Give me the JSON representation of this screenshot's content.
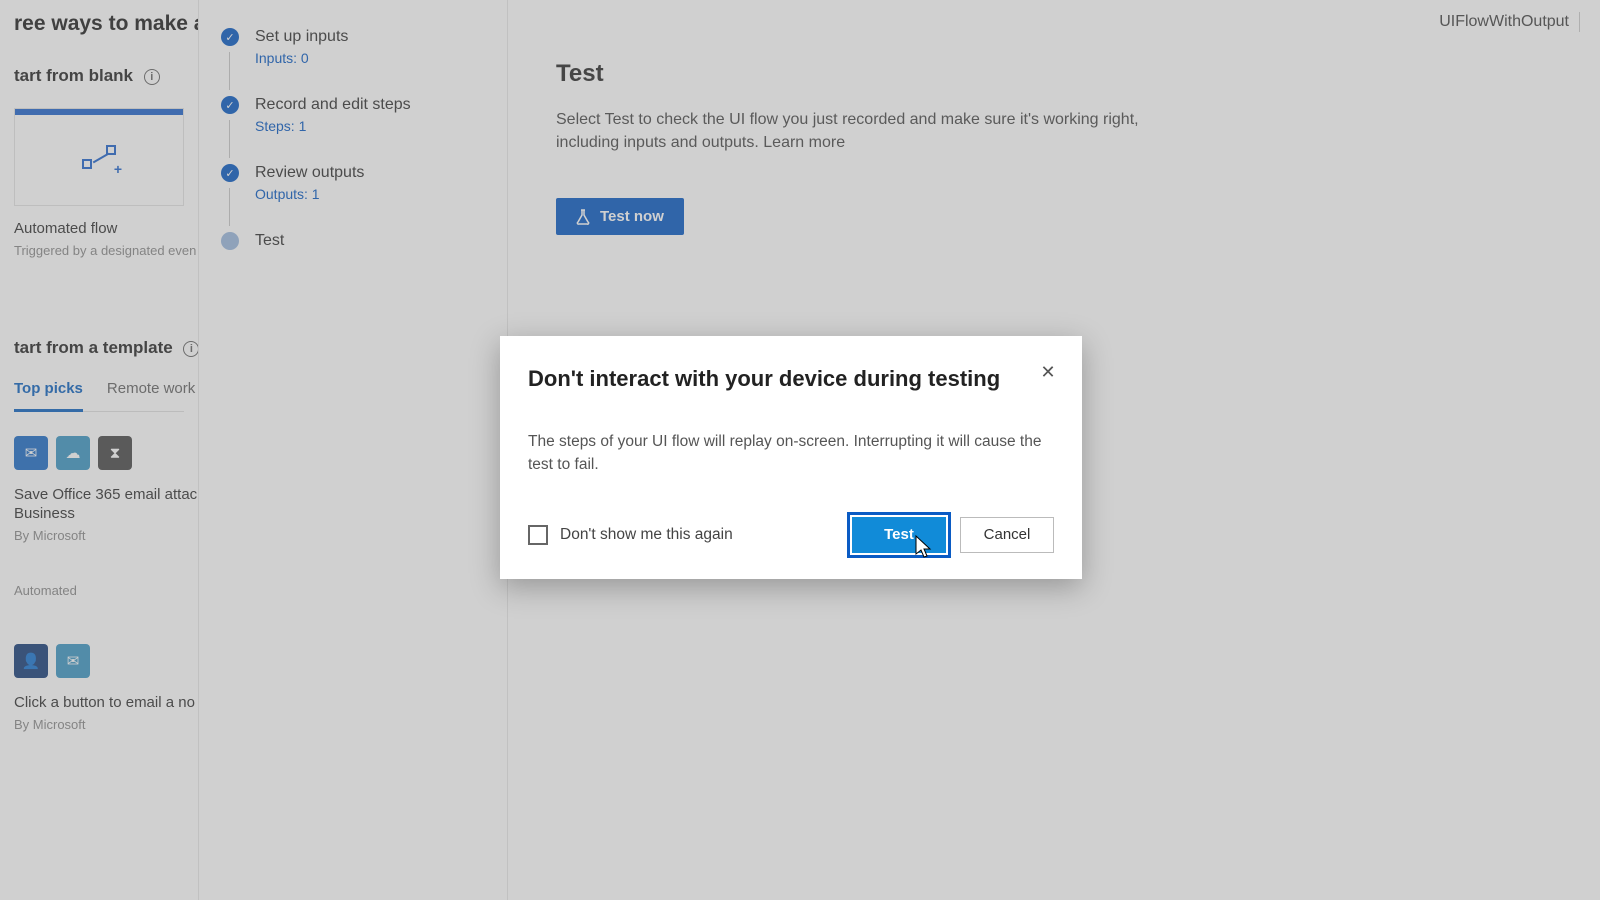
{
  "header": {
    "flow_name": "UIFlowWithOutput"
  },
  "left": {
    "heading": "ree ways to make a flo",
    "start_blank": "tart from blank",
    "card_auto_title": "Automated flow",
    "card_auto_sub": "Triggered by a designated even",
    "start_template": "tart from a template",
    "tabs": {
      "top": "Top picks",
      "remote": "Remote work"
    },
    "tmpl1_title": "Save Office 365 email attac",
    "tmpl1_title2": "Business",
    "tmpl1_by": "By Microsoft",
    "tmpl1_type": "Automated",
    "tmpl2_title": "Click a button to email a no",
    "tmpl2_by": "By Microsoft"
  },
  "steps": [
    {
      "label": "Set up inputs",
      "meta": "Inputs: 0",
      "state": "done"
    },
    {
      "label": "Record and edit steps",
      "meta": "Steps: 1",
      "state": "done"
    },
    {
      "label": "Review outputs",
      "meta": "Outputs: 1",
      "state": "done"
    },
    {
      "label": "Test",
      "meta": "",
      "state": "current"
    }
  ],
  "main": {
    "title": "Test",
    "desc": "Select Test to check the UI flow you just recorded and make sure it's working right, including inputs and outputs. ",
    "learn_more": "Learn more",
    "test_now": "Test now"
  },
  "modal": {
    "title": "Don't interact with your device during testing",
    "body": "The steps of your UI flow will replay on-screen. Interrupting it will cause the test to fail.",
    "dont_show": "Don't show me this again",
    "btn_test": "Test",
    "btn_cancel": "Cancel"
  }
}
